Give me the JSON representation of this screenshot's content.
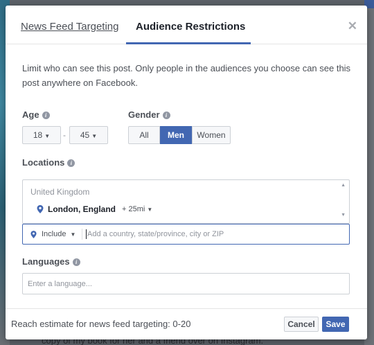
{
  "background": {
    "bottom_text": "copy of my book for her and a friend over on Instagram."
  },
  "tabs": [
    {
      "label": "News Feed Targeting",
      "active": false
    },
    {
      "label": "Audience Restrictions",
      "active": true
    }
  ],
  "close_icon": "close-icon",
  "description": "Limit who can see this post. Only people in the audiences you choose can see this post anywhere on Facebook.",
  "age": {
    "label": "Age",
    "min": "18",
    "max": "45",
    "separator": "-"
  },
  "gender": {
    "label": "Gender",
    "options": [
      "All",
      "Men",
      "Women"
    ],
    "selected": "Men"
  },
  "locations": {
    "label": "Locations",
    "country": "United Kingdom",
    "city": "London, England",
    "radius": "+ 25mi",
    "include_label": "Include",
    "input_placeholder": "Add a country, state/province, city or ZIP"
  },
  "languages": {
    "label": "Languages",
    "placeholder": "Enter a language..."
  },
  "footer": {
    "reach": "Reach estimate for news feed targeting: 0-20",
    "cancel_label": "Cancel",
    "save_label": "Save"
  },
  "colors": {
    "accent": "#4267b2",
    "border": "#ccd0d5",
    "text": "#4b4f56"
  }
}
